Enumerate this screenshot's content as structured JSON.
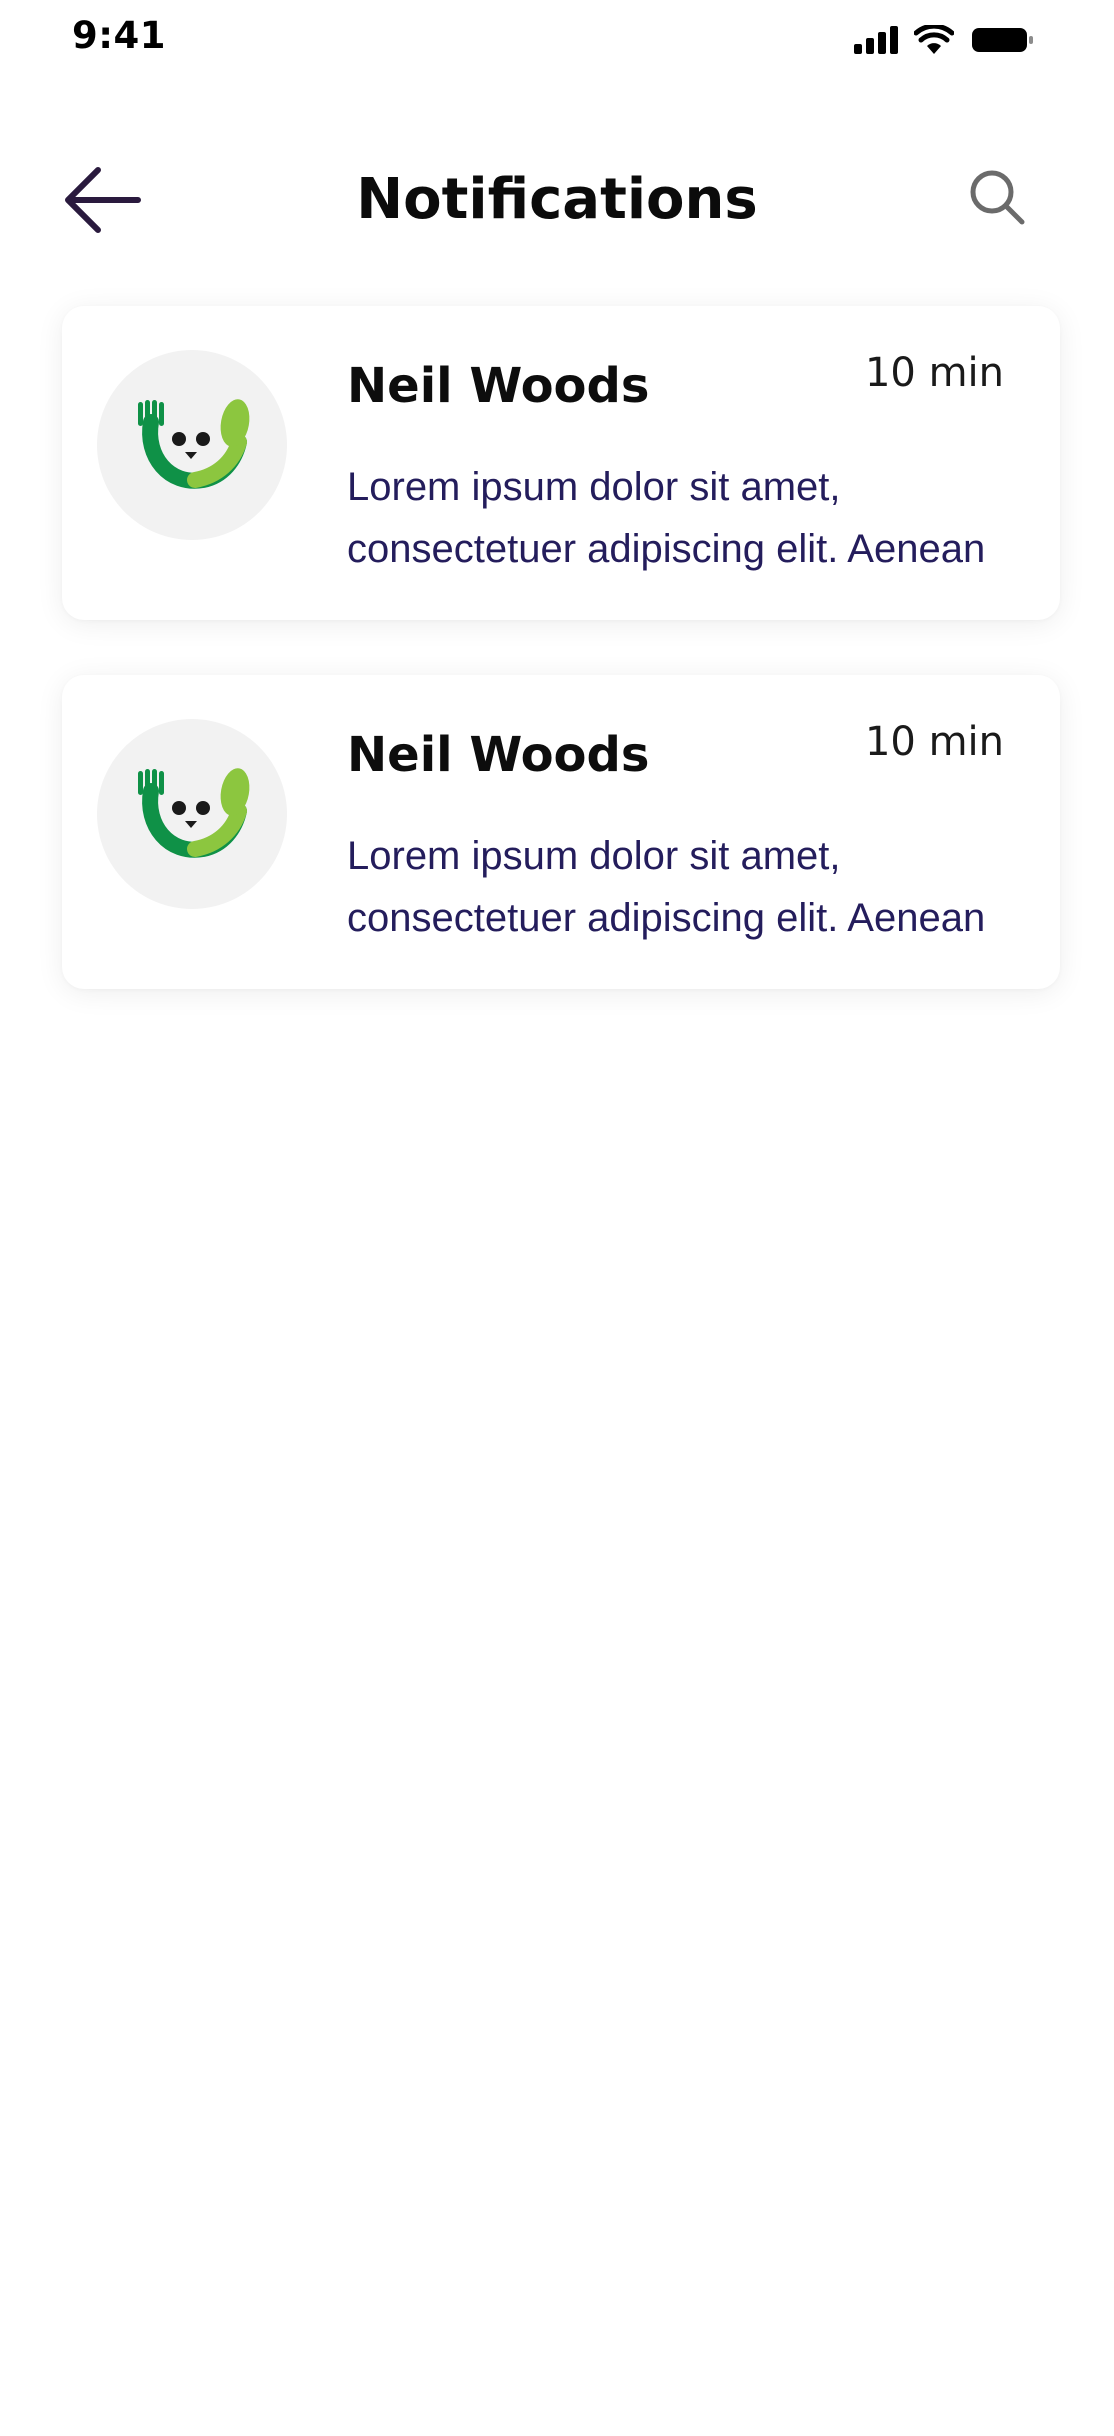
{
  "status_bar": {
    "time": "9:41",
    "icons": [
      "signal-icon",
      "wifi-icon",
      "battery-icon"
    ]
  },
  "header": {
    "title": "Notifications",
    "back_icon": "arrow-left-icon",
    "search_icon": "search-icon"
  },
  "colors": {
    "title": "#0b0b0b",
    "body_text": "#241d5c",
    "back_arrow": "#2a1a3e",
    "search_icon": "#6b6b6b",
    "avatar_bg": "#f2f2f2",
    "logo_dark_green": "#0f9147",
    "logo_light_green": "#8cc63f"
  },
  "notifications": [
    {
      "name": "Neil Woods",
      "time": "10 min",
      "message": "Lorem ipsum dolor sit amet, consectetuer adipiscing elit. Aenean",
      "avatar_icon": "fork-spoon-smiley-logo-icon"
    },
    {
      "name": "Neil Woods",
      "time": "10 min",
      "message": "Lorem ipsum dolor sit amet, consectetuer adipiscing elit. Aenean",
      "avatar_icon": "fork-spoon-smiley-logo-icon"
    }
  ]
}
